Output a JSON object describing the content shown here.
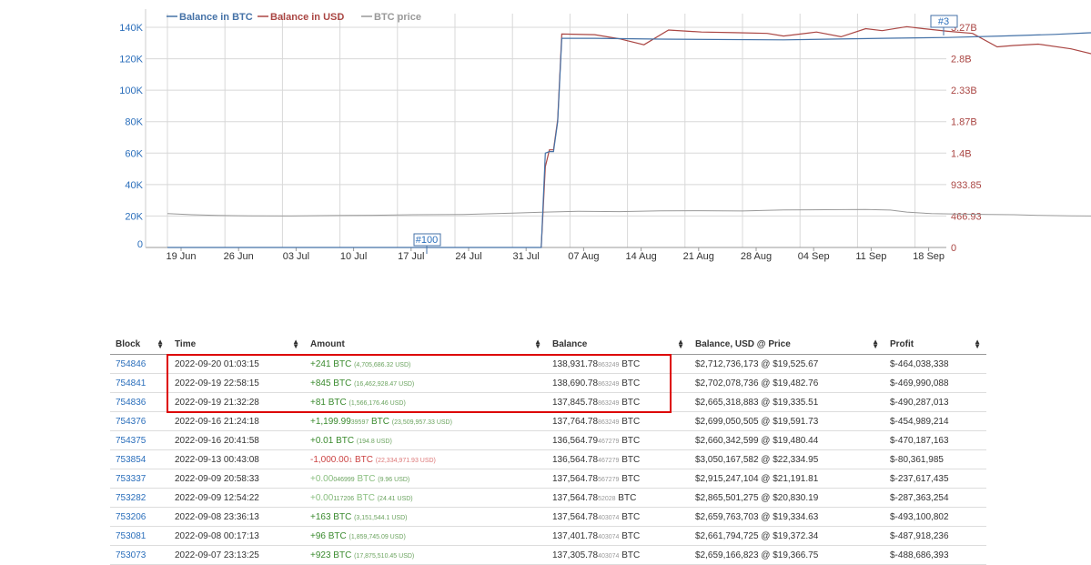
{
  "chart_data": {
    "type": "line",
    "legend_position": "top-left",
    "series": [
      {
        "name": "Balance in BTC",
        "color": "#4572a7",
        "axis": "left"
      },
      {
        "name": "Balance in USD",
        "color": "#aa4643",
        "axis": "right"
      },
      {
        "name": "BTC price",
        "color": "#999999",
        "axis": "left"
      }
    ],
    "x_ticks": [
      "19 Jun",
      "26 Jun",
      "03 Jul",
      "10 Jul",
      "17 Jul",
      "24 Jul",
      "31 Jul",
      "07 Aug",
      "14 Aug",
      "21 Aug",
      "28 Aug",
      "04 Sep",
      "11 Sep",
      "18 Sep"
    ],
    "y_left_ticks": [
      "0",
      "20K",
      "40K",
      "60K",
      "80K",
      "100K",
      "120K",
      "140K"
    ],
    "y_right_ticks": [
      "0",
      "466.93",
      "933.85",
      "1.4B",
      "1.87B",
      "2.33B",
      "2.8B",
      "3.27B"
    ],
    "grid": true,
    "annotations": [
      "#100",
      "#3"
    ],
    "btc_balance": [
      [
        0,
        0
      ],
      [
        45.5,
        0
      ],
      [
        46,
        60000
      ],
      [
        46.5,
        61000
      ],
      [
        47,
        61000
      ],
      [
        47.5,
        80000
      ],
      [
        48,
        133000
      ],
      [
        52,
        133000
      ],
      [
        60,
        132500
      ],
      [
        75,
        132000
      ],
      [
        87,
        133000
      ],
      [
        95,
        133500
      ],
      [
        102,
        134500
      ],
      [
        108,
        135500
      ],
      [
        112,
        136500
      ],
      [
        117,
        137000
      ],
      [
        122,
        137500
      ],
      [
        128,
        137300
      ],
      [
        134,
        138300
      ],
      [
        136,
        138900
      ]
    ],
    "usd_balance": [
      [
        45.5,
        0
      ],
      [
        46,
        1.2
      ],
      [
        46.5,
        1.45
      ],
      [
        47,
        1.45
      ],
      [
        47.5,
        1.9
      ],
      [
        48,
        3.17
      ],
      [
        52,
        3.16
      ],
      [
        55,
        3.1
      ],
      [
        58,
        3.01
      ],
      [
        61,
        3.23
      ],
      [
        65,
        3.2
      ],
      [
        69,
        3.19
      ],
      [
        73,
        3.18
      ],
      [
        75,
        3.14
      ],
      [
        79,
        3.2
      ],
      [
        82,
        3.13
      ],
      [
        85,
        3.25
      ],
      [
        87,
        3.22
      ],
      [
        90,
        3.28
      ],
      [
        92,
        3.25
      ],
      [
        95,
        3.21
      ],
      [
        98,
        3.18
      ],
      [
        101,
        2.98
      ],
      [
        103,
        3.0
      ],
      [
        106,
        3.02
      ],
      [
        110,
        2.95
      ],
      [
        113,
        2.86
      ],
      [
        116,
        2.8
      ],
      [
        119,
        2.82
      ],
      [
        122,
        2.76
      ],
      [
        124,
        2.79
      ],
      [
        126,
        2.7
      ],
      [
        128,
        2.72
      ],
      [
        130,
        2.92
      ],
      [
        131.5,
        3.05
      ],
      [
        133,
        2.84
      ],
      [
        134,
        2.78
      ],
      [
        135,
        2.76
      ],
      [
        136,
        2.8
      ]
    ],
    "btc_price": [
      [
        0,
        21500
      ],
      [
        3,
        20800
      ],
      [
        6,
        20400
      ],
      [
        10,
        20100
      ],
      [
        15,
        20000
      ],
      [
        20,
        20300
      ],
      [
        25,
        20500
      ],
      [
        30,
        20800
      ],
      [
        36,
        21000
      ],
      [
        42,
        21800
      ],
      [
        46,
        22500
      ],
      [
        50,
        23000
      ],
      [
        55,
        22800
      ],
      [
        60,
        23300
      ],
      [
        65,
        23400
      ],
      [
        70,
        23200
      ],
      [
        75,
        23900
      ],
      [
        80,
        24000
      ],
      [
        85,
        24200
      ],
      [
        88,
        23800
      ],
      [
        90,
        22500
      ],
      [
        93,
        21500
      ],
      [
        96,
        21300
      ],
      [
        100,
        21000
      ],
      [
        103,
        20800
      ],
      [
        106,
        20400
      ],
      [
        110,
        20100
      ],
      [
        113,
        20000
      ],
      [
        116,
        19800
      ],
      [
        118,
        19900
      ],
      [
        121,
        20100
      ],
      [
        124,
        20900
      ],
      [
        126,
        21100
      ],
      [
        128,
        20100
      ],
      [
        130,
        19800
      ],
      [
        133,
        19400
      ],
      [
        136,
        19500
      ]
    ]
  },
  "table": {
    "headers": [
      "Block",
      "Time",
      "Amount",
      "Balance",
      "Balance, USD @ Price",
      "Profit"
    ],
    "rows": [
      {
        "block": "754846",
        "time": "2022-09-20 01:03:15",
        "amt_main": "+241",
        "amt_frac": "",
        "amt_unit": " BTC ",
        "amt_usd": "(4,705,686.32 USD)",
        "amt_class": "pos",
        "bal_main": "138,931.78",
        "bal_frac": "863249",
        "bal_unit": " BTC",
        "usd": "$2,712,736,173 @ $19,525.67",
        "profit": "$-464,038,338"
      },
      {
        "block": "754841",
        "time": "2022-09-19 22:58:15",
        "amt_main": "+845",
        "amt_frac": "",
        "amt_unit": " BTC ",
        "amt_usd": "(16,462,928.47 USD)",
        "amt_class": "pos",
        "bal_main": "138,690.78",
        "bal_frac": "863249",
        "bal_unit": " BTC",
        "usd": "$2,702,078,736 @ $19,482.76",
        "profit": "$-469,990,088"
      },
      {
        "block": "754836",
        "time": "2022-09-19 21:32:28",
        "amt_main": "+81",
        "amt_frac": "",
        "amt_unit": " BTC ",
        "amt_usd": "(1,566,176.46 USD)",
        "amt_class": "pos",
        "bal_main": "137,845.78",
        "bal_frac": "863249",
        "bal_unit": " BTC",
        "usd": "$2,665,318,883 @ $19,335.51",
        "profit": "$-490,287,013"
      },
      {
        "block": "754376",
        "time": "2022-09-16 21:24:18",
        "amt_main": "+1,199.99",
        "amt_frac": "39597",
        "amt_unit": " BTC ",
        "amt_usd": "(23,509,957.33 USD)",
        "amt_class": "pos",
        "bal_main": "137,764.78",
        "bal_frac": "863249",
        "bal_unit": " BTC",
        "usd": "$2,699,050,505 @ $19,591.73",
        "profit": "$-454,989,214"
      },
      {
        "block": "754375",
        "time": "2022-09-16 20:41:58",
        "amt_main": "+0.01",
        "amt_frac": "",
        "amt_unit": " BTC ",
        "amt_usd": "(194.8 USD)",
        "amt_class": "pos",
        "bal_main": "136,564.79",
        "bal_frac": "467279",
        "bal_unit": " BTC",
        "usd": "$2,660,342,599 @ $19,480.44",
        "profit": "$-470,187,163"
      },
      {
        "block": "753854",
        "time": "2022-09-13 00:43:08",
        "amt_main": "-1,000.00",
        "amt_frac": "1",
        "amt_unit": " BTC ",
        "amt_usd": "(22,334,971.93 USD)",
        "amt_class": "neg",
        "bal_main": "136,564.78",
        "bal_frac": "467279",
        "bal_unit": " BTC",
        "usd": "$3,050,167,582 @ $22,334.95",
        "profit": "$-80,361,985"
      },
      {
        "block": "753337",
        "time": "2022-09-09 20:58:33",
        "amt_main": "+0.00",
        "amt_frac": "046999",
        "amt_unit": " BTC ",
        "amt_usd": "(9.96 USD)",
        "amt_class": "pos muted",
        "bal_main": "137,564.78",
        "bal_frac": "567279",
        "bal_unit": " BTC",
        "usd": "$2,915,247,104 @ $21,191.81",
        "profit": "$-237,617,435"
      },
      {
        "block": "753282",
        "time": "2022-09-09 12:54:22",
        "amt_main": "+0.00",
        "amt_frac": "117206",
        "amt_unit": " BTC ",
        "amt_usd": "(24.41 USD)",
        "amt_class": "pos muted",
        "bal_main": "137,564.78",
        "bal_frac": "52028",
        "bal_unit": " BTC",
        "usd": "$2,865,501,275 @ $20,830.19",
        "profit": "$-287,363,254"
      },
      {
        "block": "753206",
        "time": "2022-09-08 23:36:13",
        "amt_main": "+163",
        "amt_frac": "",
        "amt_unit": " BTC ",
        "amt_usd": "(3,151,544.1 USD)",
        "amt_class": "pos",
        "bal_main": "137,564.78",
        "bal_frac": "403074",
        "bal_unit": " BTC",
        "usd": "$2,659,763,703 @ $19,334.63",
        "profit": "$-493,100,802"
      },
      {
        "block": "753081",
        "time": "2022-09-08 00:17:13",
        "amt_main": "+96",
        "amt_frac": "",
        "amt_unit": " BTC ",
        "amt_usd": "(1,859,745.09 USD)",
        "amt_class": "pos",
        "bal_main": "137,401.78",
        "bal_frac": "403074",
        "bal_unit": " BTC",
        "usd": "$2,661,794,725 @ $19,372.34",
        "profit": "$-487,918,236"
      },
      {
        "block": "753073",
        "time": "2022-09-07 23:13:25",
        "amt_main": "+923",
        "amt_frac": "",
        "amt_unit": " BTC ",
        "amt_usd": "(17,875,510.45 USD)",
        "amt_class": "pos",
        "bal_main": "137,305.78",
        "bal_frac": "403074",
        "bal_unit": " BTC",
        "usd": "$2,659,166,823 @ $19,366.75",
        "profit": "$-488,686,393"
      }
    ]
  }
}
